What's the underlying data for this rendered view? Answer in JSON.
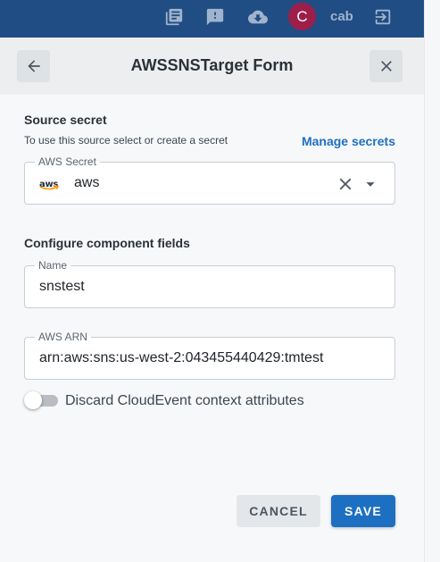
{
  "topbar": {
    "icons": [
      "docs-icon",
      "feedback-icon",
      "download-icon",
      "logout-icon"
    ],
    "avatar_initial": "C",
    "username": "cab",
    "color": "#1f4d84"
  },
  "form": {
    "title": "AWSSNSTarget Form",
    "back_icon": "arrow-left-icon",
    "close_icon": "close-icon"
  },
  "source_secret": {
    "title": "Source secret",
    "helper": "To use this source select or create a secret",
    "manage_link": "Manage secrets",
    "field_label": "AWS Secret",
    "logo_text": "aws",
    "selected_value": "aws"
  },
  "component_fields": {
    "title": "Configure component fields",
    "name_label": "Name",
    "name_value": "snstest",
    "arn_label": "AWS ARN",
    "arn_value": "arn:aws:sns:us-west-2:043455440429:tmtest"
  },
  "discard_toggle": {
    "label": "Discard CloudEvent context attributes",
    "on": false
  },
  "actions": {
    "cancel_label": "CANCEL",
    "save_label": "SAVE",
    "accent": "#1d6fc2"
  }
}
